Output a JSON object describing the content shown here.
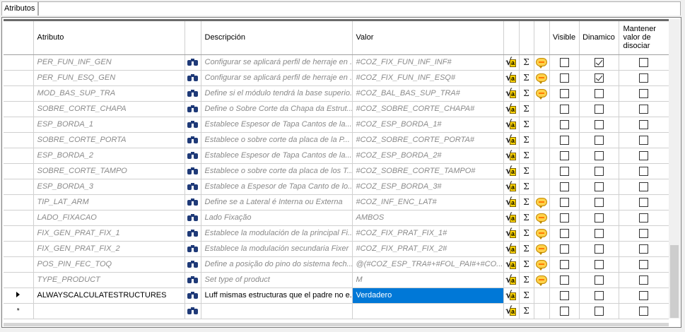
{
  "tab": {
    "label": "Atributos"
  },
  "headers": {
    "atributo": "Atributo",
    "descripcion": "Descripción",
    "valor": "Valor",
    "visible": "Visible",
    "dinamico": "Dinamico",
    "mantener": [
      "Mantener",
      "valor de",
      "disociar"
    ]
  },
  "rows": [
    {
      "atributo": "PER_FUN_INF_GEN",
      "descripcion": "Configurar se aplicará perfil de herraje en ...",
      "valor": "#COZ_FIX_FUN_INF_INF#",
      "bubble": true,
      "visible": false,
      "dinamico": true,
      "mantener": false
    },
    {
      "atributo": "PER_FUN_ESQ_GEN",
      "descripcion": "Configurar se aplicará perfil de herraje en ...",
      "valor": "#COZ_FIX_FUN_INF_ESQ#",
      "bubble": true,
      "visible": false,
      "dinamico": true,
      "mantener": false
    },
    {
      "atributo": "MOD_BAS_SUP_TRA",
      "descripcion": "Define si el módulo tendrá la base superio...",
      "valor": "#COZ_BAL_BAS_SUP_TRA#",
      "bubble": true,
      "visible": false,
      "dinamico": false,
      "mantener": false
    },
    {
      "atributo": "SOBRE_CORTE_CHAPA",
      "descripcion": "Define o Sobre Corte da Chapa da Estrut...",
      "valor": "#COZ_SOBRE_CORTE_CHAPA#",
      "bubble": false,
      "visible": false,
      "dinamico": false,
      "mantener": false
    },
    {
      "atributo": "ESP_BORDA_1",
      "descripcion": "Establece Espesor de Tapa Cantos de la...",
      "valor": "#COZ_ESP_BORDA_1#",
      "bubble": false,
      "visible": false,
      "dinamico": false,
      "mantener": false
    },
    {
      "atributo": "SOBRE_CORTE_PORTA",
      "descripcion": "Establece o sobre corte da placa de la P...",
      "valor": "#COZ_SOBRE_CORTE_PORTA#",
      "bubble": false,
      "visible": false,
      "dinamico": false,
      "mantener": false
    },
    {
      "atributo": "ESP_BORDA_2",
      "descripcion": "Establece Espesor de Tapa Cantos de la...",
      "valor": "#COZ_ESP_BORDA_2#",
      "bubble": false,
      "visible": false,
      "dinamico": false,
      "mantener": false
    },
    {
      "atributo": "SOBRE_CORTE_TAMPO",
      "descripcion": "Establece o sobre corte da placa de los T...",
      "valor": "#COZ_SOBRE_CORTE_TAMPO#",
      "bubble": false,
      "visible": false,
      "dinamico": false,
      "mantener": false
    },
    {
      "atributo": "ESP_BORDA_3",
      "descripcion": "Establece a Espesor de Tapa Canto de lo...",
      "valor": "#COZ_ESP_BORDA_3#",
      "bubble": false,
      "visible": false,
      "dinamico": false,
      "mantener": false
    },
    {
      "atributo": "TIP_LAT_ARM",
      "descripcion": "Define se a Lateral é Interna ou Externa",
      "valor": "#COZ_INF_ENC_LAT#",
      "bubble": true,
      "visible": false,
      "dinamico": false,
      "mantener": false
    },
    {
      "atributo": "LADO_FIXACAO",
      "descripcion": "Lado Fixação",
      "valor": "AMBOS",
      "bubble": true,
      "visible": false,
      "dinamico": false,
      "mantener": false
    },
    {
      "atributo": "FIX_GEN_PRAT_FIX_1",
      "descripcion": "Establece la modulación de la principal Fi...",
      "valor": "#COZ_FIX_PRAT_FIX_1#",
      "bubble": true,
      "visible": false,
      "dinamico": false,
      "mantener": false
    },
    {
      "atributo": "FIX_GEN_PRAT_FIX_2",
      "descripcion": "Establece la modulación secundaria Fixer",
      "valor": "#COZ_FIX_PRAT_FIX_2#",
      "bubble": true,
      "visible": false,
      "dinamico": false,
      "mantener": false
    },
    {
      "atributo": "POS_PIN_FEC_TOQ",
      "descripcion": "Define a posição do pino do sistema fech...",
      "valor": "@(#COZ_ESP_TRA#+#FOL_PAI#+#CO...",
      "bubble": true,
      "visible": false,
      "dinamico": false,
      "mantener": false
    },
    {
      "atributo": "TYPE_PRODUCT",
      "descripcion": "Set type of product",
      "valor": "M",
      "bubble": true,
      "visible": false,
      "dinamico": false,
      "mantener": false
    },
    {
      "atributo": "ALWAYSCALCULATESTRUCTURES",
      "descripcion": "Luff mismas estructuras que el padre no e...",
      "valor": "Verdadero",
      "bubble": false,
      "visible": false,
      "dinamico": false,
      "mantener": false,
      "current": true
    },
    {
      "atributo": "",
      "descripcion": "",
      "valor": "",
      "bubble": false,
      "visible": false,
      "dinamico": false,
      "mantener": false,
      "newrow": true
    }
  ],
  "icons": {
    "search": "binoculars-icon",
    "formula": "sqrt-formula-icon",
    "sum": "sigma-icon",
    "comment": "speech-bubble-icon"
  },
  "glyphs": {
    "sigma": "Σ",
    "newrow": "*"
  },
  "colors": {
    "selection": "#0078d7",
    "inactive_text": "#8a8a8a",
    "checkbox_border": "#333333"
  }
}
